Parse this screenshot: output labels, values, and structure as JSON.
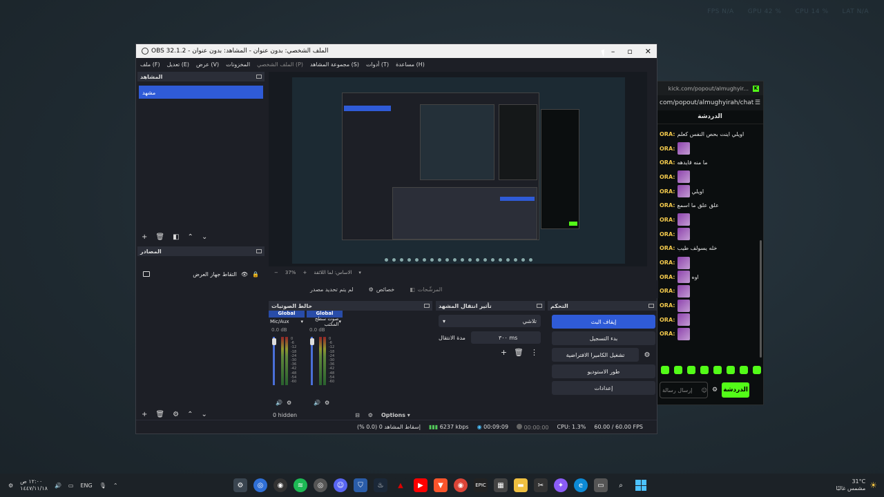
{
  "overlay": {
    "fps_label": "FPS",
    "fps": "N/A",
    "gpu_label": "GPU",
    "gpu": "42 %",
    "cpu_label": "CPU",
    "cpu": "14 %",
    "lat_label": "LAT",
    "lat": "N/A"
  },
  "obs": {
    "title": "OBS 32.1.2 - الملف الشخصي: بدون عنوان - المشاهد: بدون عنوان",
    "menu": [
      "ملف (F)",
      "تعديل (E)",
      "عرض (V)",
      "المخزونات",
      "الملف الشخصي (P)",
      "مجموعة المشاهد (S)",
      "أدوات (T)",
      "مساعدة (H)"
    ],
    "scenes": {
      "title": "المشاهد",
      "items": [
        "مشهد"
      ]
    },
    "sources": {
      "title": "المصادر",
      "items": [
        {
          "name": "التقاط جهاز العرض"
        }
      ]
    },
    "preview": {
      "zoom": "37%",
      "scale_label": "الاساس: لما اللائقة"
    },
    "tabs": {
      "filters": "المرشّحات",
      "properties": "خصائص",
      "no_source": "لم يتم تحديد مصدر"
    },
    "mixer": {
      "title": "خالط الصوتيات",
      "channels": [
        {
          "label": "Global",
          "name": "Mic/Aux",
          "db": "0.0 dB"
        },
        {
          "label": "Global",
          "name": "صوت سطح المكتب",
          "db": "0.0 dB"
        }
      ],
      "scale": [
        "0",
        "-6",
        "-12",
        "-18",
        "-24",
        "-30",
        "-36",
        "-42",
        "-48",
        "-54",
        "-60"
      ],
      "hidden": "0 hidden",
      "options": "Options"
    },
    "transitions": {
      "title": "تأثير انتقال المشهد",
      "type": "تلاشي",
      "duration_label": "مدة الانتقال",
      "duration": "٣٠٠ ms"
    },
    "controls": {
      "title": "التحكم",
      "start_stream": "إيقاف البث",
      "start_record": "بدء التسجيل",
      "virtual_cam": "تشغيل الكاميرا الافتراضية",
      "studio_mode": "طور الاستوديو",
      "settings": "إعدادات"
    },
    "status": {
      "dropped": "إسقاط المشاهد 0 (0.0 %)",
      "bitrate": "6237 kbps",
      "stream_time": "00:09:09",
      "rec_time": "00:00:00",
      "cpu": "CPU: 1.3%",
      "fps": "60.00 / 60.00 FPS"
    }
  },
  "chat": {
    "url_short": "kick.com/popout/almughyir...",
    "url": "com/popout/almughyirah/chat",
    "header": "الدردشة",
    "user": "ORA:",
    "messages": [
      "اويلي اينت بحص النفس كعلم",
      "",
      "ما منه قايدهه",
      "",
      "اويلي",
      "علق علق ما اسمع",
      "",
      "",
      "خله يسولف طيب",
      "",
      "اوه",
      "",
      "",
      "",
      ""
    ],
    "input_placeholder": "إرسال رسالة",
    "send": "الدردشة"
  },
  "taskbar": {
    "time": "١٢:٠٠ ص",
    "date": "١٤٤٧/١١/١٨",
    "lang": "ENG",
    "temp": "31°C",
    "weather": "مشمس غالبًا"
  }
}
